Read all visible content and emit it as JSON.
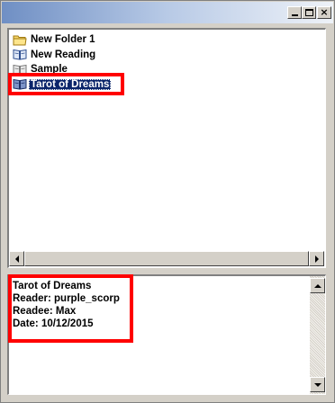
{
  "window": {
    "controls": {
      "minimize_icon": "minimize-icon",
      "maximize_icon": "maximize-icon",
      "close_glyph": "×"
    }
  },
  "tree": {
    "items": [
      {
        "label": "New Folder 1",
        "icon": "folder-icon",
        "selected": false
      },
      {
        "label": "New Reading",
        "icon": "book-icon",
        "selected": false
      },
      {
        "label": "Sample",
        "icon": "book-icon",
        "selected": false
      },
      {
        "label": "Tarot of Dreams",
        "icon": "book-icon",
        "selected": true
      }
    ]
  },
  "details": {
    "lines": [
      "Tarot of Dreams",
      "Reader: purple_scorp",
      "Readee: Max",
      "Date: 10/12/2015"
    ]
  },
  "colors": {
    "selection": "#0a246a",
    "highlight_box": "#ff0000",
    "titlebar_start": "#6f8fc4",
    "titlebar_end": "#eef2f8"
  }
}
